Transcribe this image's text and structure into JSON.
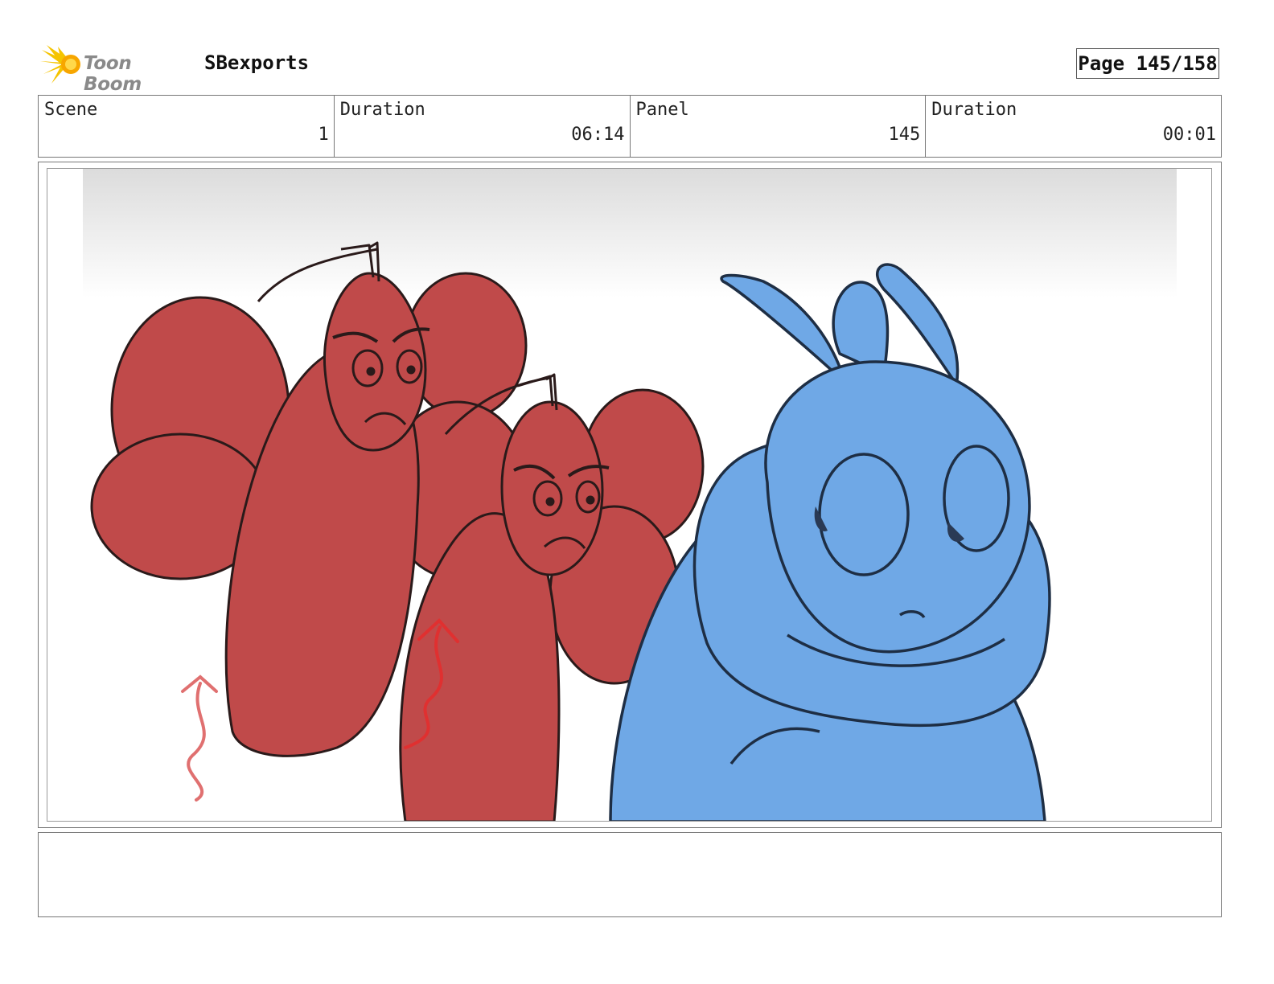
{
  "header": {
    "logo_text": "Toon Boom",
    "project_name": "SBexports",
    "page_label": "Page 145/158"
  },
  "info": {
    "scene_label": "Scene",
    "scene_value": "1",
    "scene_duration_label": "Duration",
    "scene_duration_value": "06:14",
    "panel_label": "Panel",
    "panel_value": "145",
    "panel_duration_label": "Duration",
    "panel_duration_value": "00:01"
  },
  "colors": {
    "red_character": "#c04a4a",
    "blue_character": "#6fa8e6",
    "outline": "#2a1a1a",
    "motion_arrow": "#e03030",
    "logo_yellow": "#f5c400"
  },
  "notes": {
    "text": ""
  }
}
